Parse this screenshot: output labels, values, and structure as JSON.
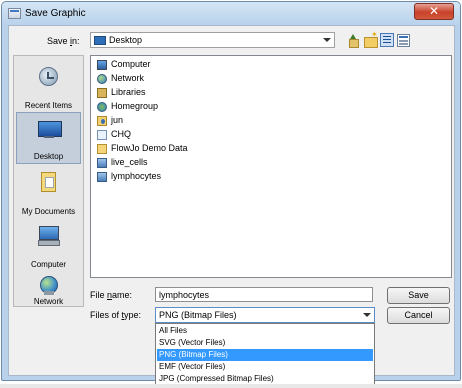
{
  "window": {
    "title": "Save Graphic",
    "close_glyph": "✕"
  },
  "save_in": {
    "label_prefix": "Save ",
    "label_underlined": "i",
    "label_suffix": "n:",
    "value": "Desktop",
    "icon": "desktop-icon"
  },
  "toolbar": {
    "icons": [
      "up-one-level-icon",
      "create-new-folder-icon",
      "list-view-icon",
      "details-view-icon"
    ]
  },
  "places": [
    {
      "label": "Recent Items",
      "icon": "recent-items-icon",
      "selected": false
    },
    {
      "label": "Desktop",
      "icon": "desktop-icon",
      "selected": true
    },
    {
      "label": "My Documents",
      "icon": "my-documents-icon",
      "selected": false
    },
    {
      "label": "Computer",
      "icon": "computer-icon",
      "selected": false
    },
    {
      "label": "Network",
      "icon": "network-icon",
      "selected": false
    }
  ],
  "files": [
    {
      "label": "Computer",
      "icon": "computer-icon"
    },
    {
      "label": "Network",
      "icon": "network-icon"
    },
    {
      "label": "Libraries",
      "icon": "libraries-icon"
    },
    {
      "label": "Homegroup",
      "icon": "homegroup-icon"
    },
    {
      "label": "jun",
      "icon": "user-folder-icon"
    },
    {
      "label": "CHQ",
      "icon": "file-icon"
    },
    {
      "label": "FlowJo Demo Data",
      "icon": "folder-icon"
    },
    {
      "label": "live_cells",
      "icon": "data-file-icon"
    },
    {
      "label": "lymphocytes",
      "icon": "data-file-icon"
    }
  ],
  "file_name": {
    "label_prefix": "File ",
    "label_underlined": "n",
    "label_suffix": "ame:",
    "value": "lymphocytes"
  },
  "files_of_type": {
    "label_prefix": "Files of ",
    "label_underlined": "t",
    "label_suffix": "ype:",
    "value": "PNG (Bitmap Files)",
    "options": [
      "All Files",
      "SVG (Vector Files)",
      "PNG (Bitmap Files)",
      "EMF (Vector Files)",
      "JPG (Compressed Bitmap Files)"
    ],
    "selected_index": 2
  },
  "buttons": {
    "save": "Save",
    "cancel": "Cancel"
  },
  "colors": {
    "selection": "#3399ff",
    "window_frame": "#b9d1ea",
    "close_button": "#c8412b"
  }
}
